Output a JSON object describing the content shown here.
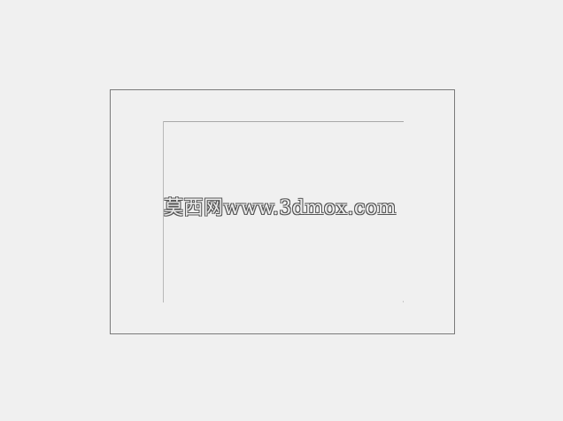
{
  "watermark": {
    "text": "莫西网www.3dmox.com"
  }
}
